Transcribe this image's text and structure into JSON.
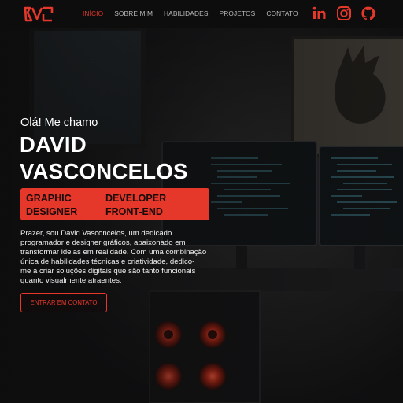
{
  "header": {
    "logo_text": "DVC",
    "nav": [
      {
        "label": "INÍCIO",
        "active": true
      },
      {
        "label": "SOBRE MIM",
        "active": false
      },
      {
        "label": "HABILIDADES",
        "active": false
      },
      {
        "label": "PROJETOS",
        "active": false
      },
      {
        "label": "CONTATO",
        "active": false
      }
    ],
    "socials": [
      "linkedin-icon",
      "instagram-icon",
      "github-icon"
    ]
  },
  "hero": {
    "greeting": "Olá! Me chamo",
    "name_line1": "DAVID",
    "name_line2": "VASCONCELOS",
    "role1_line1": "GRAPHIC",
    "role1_line2": "DESIGNER",
    "role2_line1": "DEVELOPER",
    "role2_line2": "FRONT-END",
    "intro_lines": [
      "Prazer, sou David Vasconcelos, um dedicado",
      "programador e designer gráficos, apaixonado em",
      "transformar ideias em realidade. Com uma combinação",
      "única de habilidades técnicas e criatividade, dedico-",
      "me a criar soluções digitais que são tanto funcionais",
      "quanto visualmente atraentes."
    ],
    "cta_label": "ENTRAR EM CONTATO"
  },
  "colors": {
    "accent": "#e5372a",
    "header_bg": "#0d0d0e",
    "page_bg": "#141415"
  }
}
